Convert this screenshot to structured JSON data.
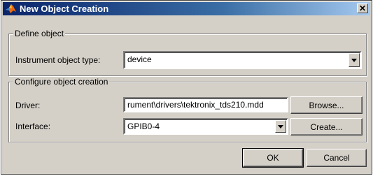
{
  "window": {
    "title": "New Object Creation",
    "icon": "matlab-logo-icon"
  },
  "define_object": {
    "legend": "Define object",
    "type_label": "Instrument object type:",
    "type_value": "device"
  },
  "configure": {
    "legend": "Configure object creation",
    "driver_label": "Driver:",
    "driver_value": "rument\\drivers\\tektronix_tds210.mdd",
    "browse_label": "Browse...",
    "interface_label": "Interface:",
    "interface_value": "GPIB0-4",
    "create_label": "Create..."
  },
  "buttons": {
    "ok": "OK",
    "cancel": "Cancel"
  },
  "colors": {
    "titlebar_start": "#0a246a",
    "titlebar_end": "#a6caf0",
    "face": "#d4d0c8"
  }
}
